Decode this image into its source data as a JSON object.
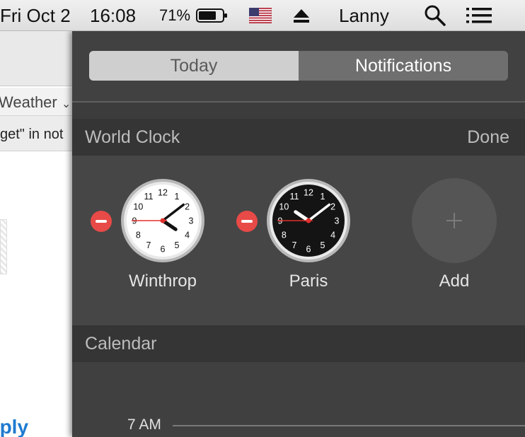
{
  "menubar": {
    "date": "Fri Oct 2",
    "time": "16:08",
    "battery": "71%",
    "user": "Lanny",
    "icons": [
      "battery-icon",
      "us-flag-icon",
      "eject-icon",
      "spotlight-search-icon",
      "notification-center-list-icon"
    ]
  },
  "background_app": {
    "weather_label": "Weather",
    "note_text": "get\" in not",
    "reply_text": "eply"
  },
  "notification_center": {
    "tabs": [
      {
        "label": "Today",
        "selected": false
      },
      {
        "label": "Notifications",
        "selected": true
      }
    ],
    "world_clock": {
      "title": "World Clock",
      "done_label": "Done",
      "clocks": [
        {
          "city": "Winthrop",
          "face": "light",
          "hour": 4,
          "minute": 8,
          "second": 45
        },
        {
          "city": "Paris",
          "face": "dark",
          "hour": 10,
          "minute": 8,
          "second": 45
        }
      ],
      "add_label": "Add",
      "add_icon": "plus-icon",
      "remove_icon": "minus-circle-icon"
    },
    "calendar": {
      "title": "Calendar",
      "time_label": "7 AM"
    }
  },
  "colors": {
    "panel_bg": "#3c3c3c",
    "remove_red": "#e84a47",
    "segment_selected": "#6f6f6f",
    "segment_unselected": "#cfcfcf"
  }
}
